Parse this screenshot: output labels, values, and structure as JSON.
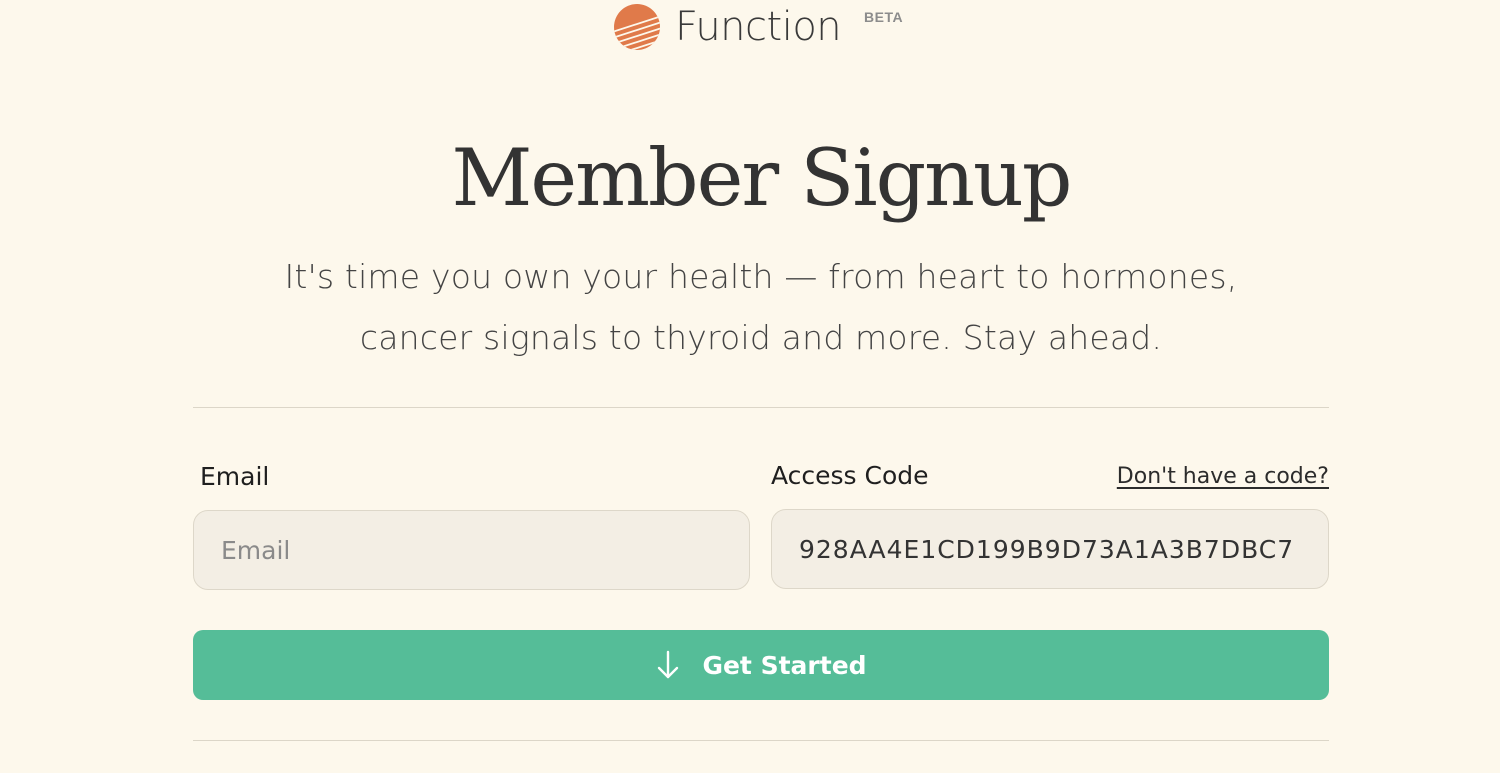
{
  "brand": {
    "name": "Function",
    "badge": "BETA",
    "logo_icon": "sun-stripes-logo-icon",
    "logo_color": "#e07a4a"
  },
  "hero": {
    "title": "Member Signup",
    "subtitle": "It's time you own your health — from heart to hormones, cancer signals to thyroid and more. Stay ahead."
  },
  "form": {
    "email": {
      "label": "Email",
      "placeholder": "Email",
      "value": ""
    },
    "access_code": {
      "label": "Access Code",
      "value": "928AA4E1CD199B9D73A1A3B7DBC7",
      "help_link": "Don't have a code?"
    },
    "submit": {
      "label": "Get Started",
      "icon": "arrow-down-icon",
      "color": "#55bd98"
    }
  },
  "colors": {
    "background": "#fdf8ec",
    "input_background": "#f3eee4",
    "accent": "#55bd98"
  }
}
